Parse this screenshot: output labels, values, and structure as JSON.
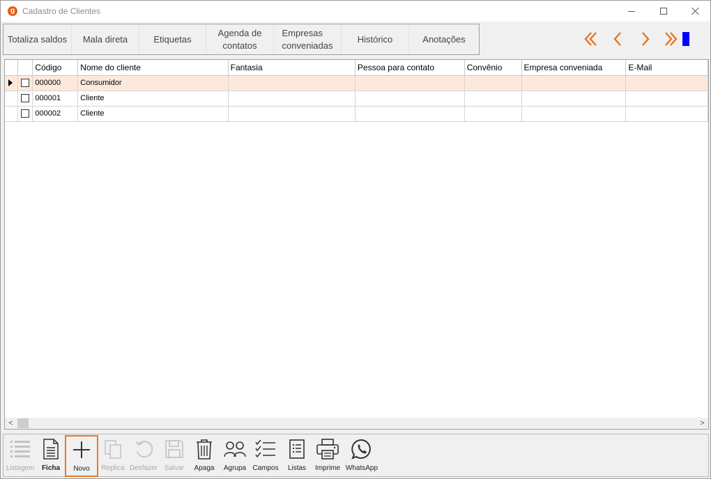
{
  "window": {
    "title": "Cadastro de Clientes",
    "icon_letter": "g"
  },
  "toolbar_top": {
    "buttons": [
      {
        "line1": "Totaliza saldos",
        "line2": ""
      },
      {
        "line1": "Mala direta",
        "line2": ""
      },
      {
        "line1": "Etiquetas",
        "line2": ""
      },
      {
        "line1": "Agenda de",
        "line2": "contatos"
      },
      {
        "line1": "Empresas",
        "line2": "conveniadas"
      },
      {
        "line1": "Histórico",
        "line2": ""
      },
      {
        "line1": "Anotações",
        "line2": ""
      }
    ],
    "nav_icons": [
      "first-icon",
      "previous-icon",
      "next-icon",
      "last-icon"
    ],
    "accent_color": "#e8741e"
  },
  "grid": {
    "columns": [
      "Código",
      "Nome do cliente",
      "Fantasia",
      "Pessoa para contato",
      "Convênio",
      "Empresa conveniada",
      "E-Mail"
    ],
    "rows": [
      {
        "codigo": "000000",
        "nome": "Consumidor",
        "fantasia": "",
        "contato": "",
        "convenio": "",
        "empresa": "",
        "email": "",
        "selected": true
      },
      {
        "codigo": "000001",
        "nome": "Cliente",
        "fantasia": "",
        "contato": "",
        "convenio": "",
        "empresa": "",
        "email": "",
        "selected": false
      },
      {
        "codigo": "000002",
        "nome": "Cliente",
        "fantasia": "",
        "contato": "",
        "convenio": "",
        "empresa": "",
        "email": "",
        "selected": false
      }
    ],
    "selected_row_color": "#fde9dc"
  },
  "toolbar_bottom": {
    "buttons": [
      {
        "label": "Listagem",
        "icon": "list-icon",
        "enabled": false
      },
      {
        "label": "Ficha",
        "icon": "form-icon",
        "enabled": true
      },
      {
        "label": "Novo",
        "icon": "plus-icon",
        "enabled": true
      },
      {
        "label": "Replica",
        "icon": "copy-icon",
        "enabled": false
      },
      {
        "label": "Desfazer",
        "icon": "undo-icon",
        "enabled": false
      },
      {
        "label": "Salvar",
        "icon": "save-icon",
        "enabled": false
      },
      {
        "label": "Apaga",
        "icon": "trash-icon",
        "enabled": true
      },
      {
        "label": "Agrupa",
        "icon": "group-icon",
        "enabled": true
      },
      {
        "label": "Campos",
        "icon": "checklist-icon",
        "enabled": true
      },
      {
        "label": "Listas",
        "icon": "lists-icon",
        "enabled": true
      },
      {
        "label": "Imprime",
        "icon": "printer-icon",
        "enabled": true
      },
      {
        "label": "WhatsApp",
        "icon": "whatsapp-icon",
        "enabled": true
      }
    ]
  }
}
